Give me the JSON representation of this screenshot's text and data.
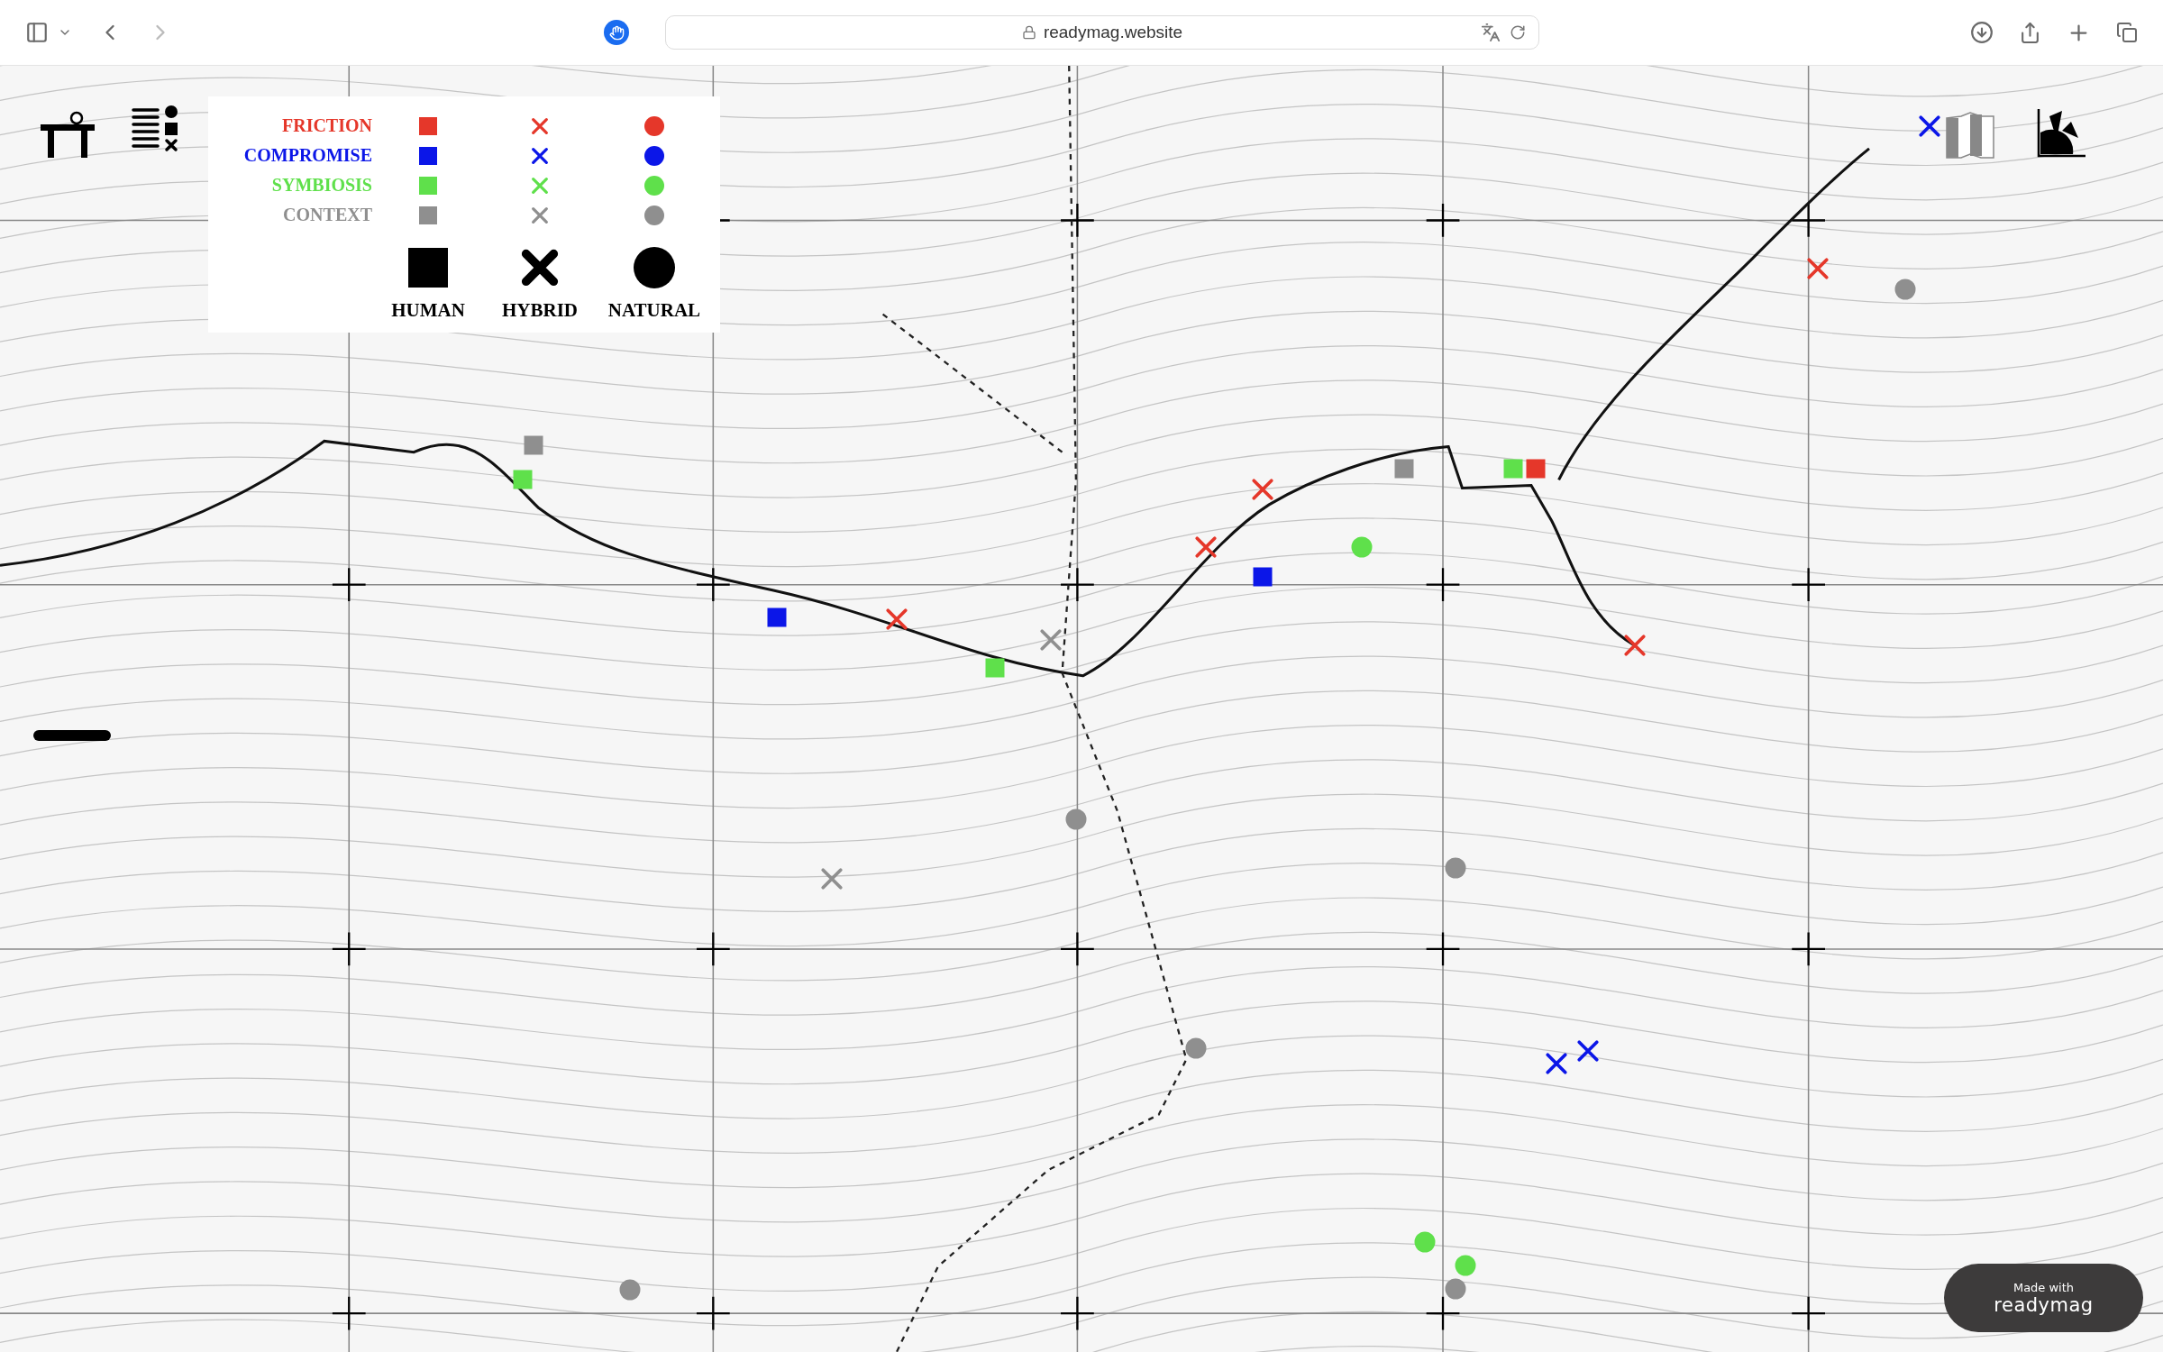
{
  "browser": {
    "address": "readymag.website"
  },
  "legend": {
    "categories": [
      {
        "label": "FRICTION",
        "color": "#e5372a"
      },
      {
        "label": "COMPROMISE",
        "color": "#0b16e8"
      },
      {
        "label": "SYMBIOSIS",
        "color": "#5fe04b"
      },
      {
        "label": "CONTEXT",
        "color": "#8f8f8f"
      }
    ],
    "types": [
      {
        "label": "HUMAN",
        "kind": "square"
      },
      {
        "label": "HYBRID",
        "kind": "cross"
      },
      {
        "label": "NATURAL",
        "kind": "circle"
      }
    ]
  },
  "markers": [
    {
      "kind": "cross",
      "color": "#0b16e8"
    },
    {
      "kind": "cross",
      "color": "#e5372a"
    },
    {
      "kind": "circle",
      "color": "#8f8f8f"
    },
    {
      "kind": "square",
      "color": "#8f8f8f"
    },
    {
      "kind": "square",
      "color": "#5fe04b"
    },
    {
      "kind": "cross",
      "color": "#e5372a"
    },
    {
      "kind": "cross",
      "color": "#e5372a"
    },
    {
      "kind": "square",
      "color": "#8f8f8f"
    },
    {
      "kind": "square",
      "color": "#5fe04b"
    },
    {
      "kind": "square",
      "color": "#e5372a"
    },
    {
      "kind": "circle",
      "color": "#5fe04b"
    },
    {
      "kind": "square",
      "color": "#0b16e8"
    },
    {
      "kind": "square",
      "color": "#0b16e8"
    },
    {
      "kind": "cross",
      "color": "#e5372a"
    },
    {
      "kind": "cross",
      "color": "#8f8f8f"
    },
    {
      "kind": "square",
      "color": "#5fe04b"
    },
    {
      "kind": "cross",
      "color": "#e5372a"
    },
    {
      "kind": "circle",
      "color": "#8f8f8f"
    },
    {
      "kind": "cross",
      "color": "#8f8f8f"
    },
    {
      "kind": "circle",
      "color": "#8f8f8f"
    },
    {
      "kind": "circle",
      "color": "#8f8f8f"
    },
    {
      "kind": "cross",
      "color": "#0b16e8"
    },
    {
      "kind": "cross",
      "color": "#0b16e8"
    },
    {
      "kind": "circle",
      "color": "#5fe04b"
    },
    {
      "kind": "circle",
      "color": "#5fe04b"
    },
    {
      "kind": "circle",
      "color": "#8f8f8f"
    },
    {
      "kind": "circle",
      "color": "#8f8f8f"
    }
  ],
  "badge": {
    "line_1": "Made with",
    "line_2": "readymag"
  }
}
